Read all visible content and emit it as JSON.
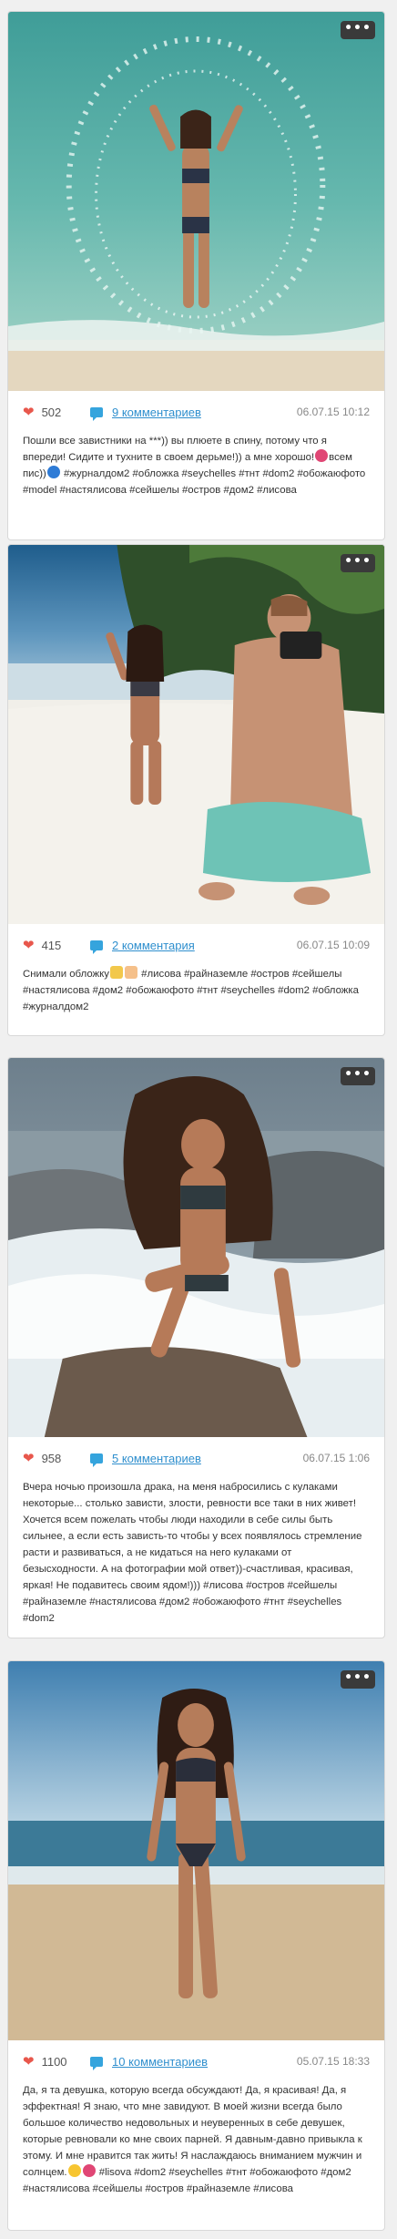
{
  "ui": {
    "more_label": "•••",
    "heart_glyph": "❤"
  },
  "colors": {
    "heart": "#e8574c",
    "link": "#2f8fce",
    "comment_icon": "#35a4dd",
    "more_button": "#3a3a3a"
  },
  "posts": [
    {
      "likes": "502",
      "comments_label": "9 комментариев",
      "date": "06.07.15 10:12",
      "text_before": "Пошли все завистники на ***)) вы плюете в спину, потому что я впереди! Сидите и тухните в своем дерьме!)) а мне хорошо!",
      "text_mid": "всем пис))",
      "text_after": " #журналдом2 #обложка #seychelles #тнт #dom2 #обожаюфото #model #настялисова #сейшелы #остров #дом2 #лисова"
    },
    {
      "likes": "415",
      "comments_label": "2 комментария",
      "date": "06.07.15 10:09",
      "text_before": "Снимали обложку",
      "text_after": " #лисова #райназемле #остров #сейшелы #настялисова #дом2 #обожаюфото #тнт #seychelles #dom2 #обложка #журналдом2"
    },
    {
      "likes": "958",
      "comments_label": "5 комментариев",
      "date": "06.07.15 1:06",
      "text": "Вчера ночью произошла драка, на меня набросились с кулаками некоторые... столько зависти, злости, ревности все таки в них живет! Хочется всем пожелать чтобы люди находили в себе силы быть сильнее, а если есть зависть-то чтобы у всех появлялось стремление расти и развиваться, а не кидаться на него кулаками от безысходности. А на фотографии мой ответ))-счастливая, красивая, яркая! Не подавитесь своим ядом!))) #лисова #остров #сейшелы #райназемле #настялисова #дом2 #обожаюфото #тнт #seychelles #dom2"
    },
    {
      "likes": "1100",
      "comments_label": "10 комментариев",
      "date": "05.07.15 18:33",
      "text_before": "Да, я та девушка, которую всегда обсуждают! Да, я красивая! Да, я эффектная! Я знаю, что мне завидуют. В моей жизни всегда было большое количество недовольных и неуверенных в себе девушек, которые ревновали ко мне своих парней. Я давным-давно привыкла к этому. И мне нравится так жить! Я наслаждаюсь вниманием мужчин и солнцем.",
      "text_after": " #lisova #dom2 #seychelles #тнт #обожаюфото #дом2 #настялисова #сейшелы #остров #райназемле #лисова"
    }
  ]
}
